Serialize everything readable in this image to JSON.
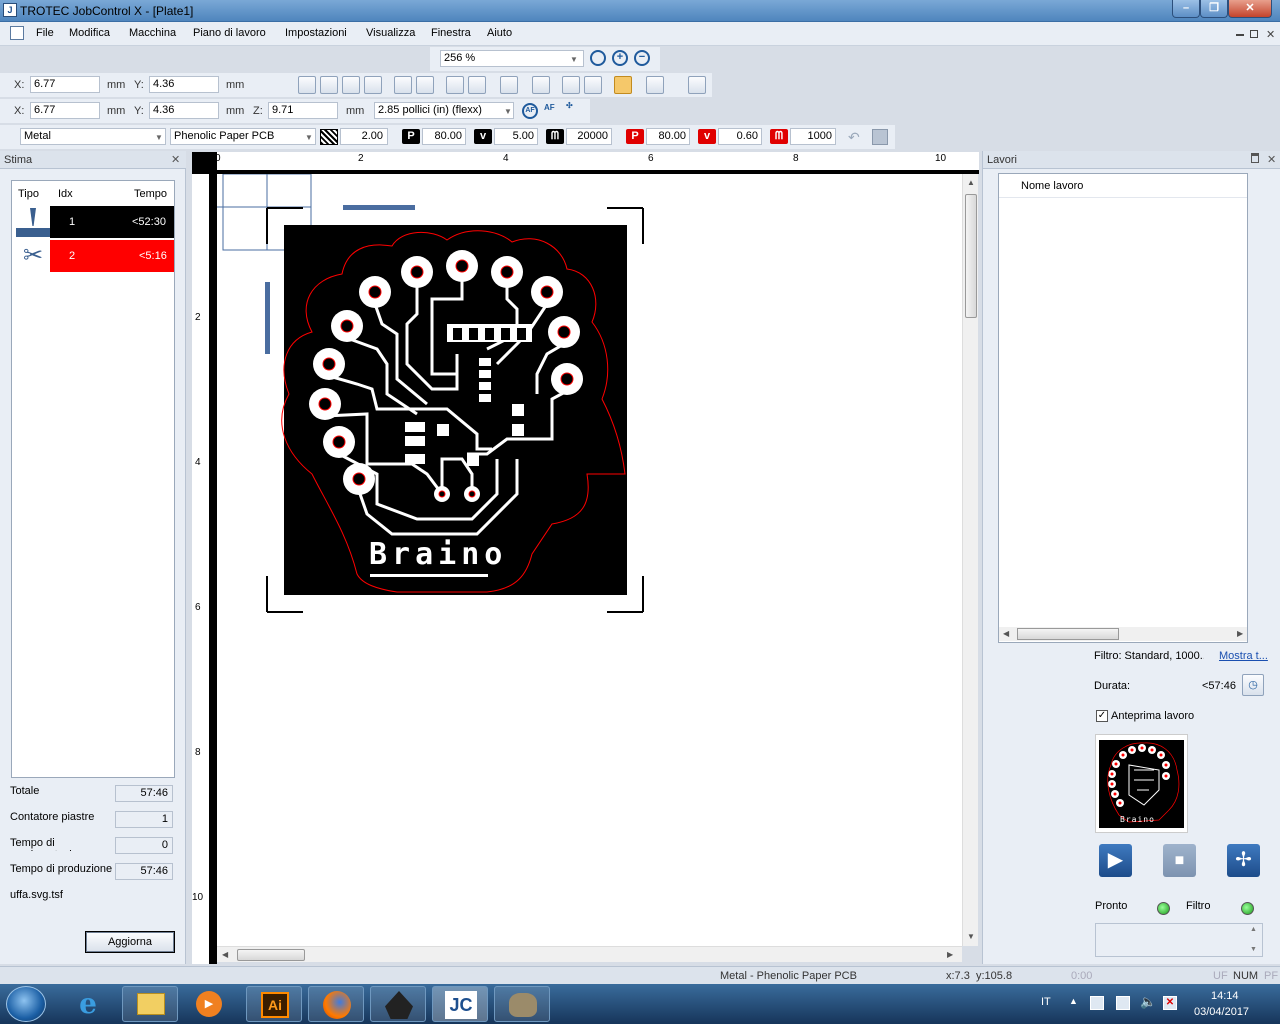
{
  "window": {
    "title": "TROTEC JobControl X - [Plate1]",
    "min": "–",
    "max": "❐",
    "close": "✕"
  },
  "menu": [
    "File",
    "Modifica",
    "Macchina",
    "Piano di lavoro",
    "Impostazioni",
    "Visualizza",
    "Finestra",
    "Aiuto"
  ],
  "zoom": {
    "value": "256 %"
  },
  "coords1": {
    "x_label": "X:",
    "x": "6.77",
    "x_unit": "mm",
    "y_label": "Y:",
    "y": "4.36",
    "y_unit": "mm"
  },
  "coords2": {
    "x_label": "X:",
    "x": "6.77",
    "x_unit": "mm",
    "y_label": "Y:",
    "y": "4.36",
    "y_unit": "mm",
    "z_label": "Z:",
    "z": "9.71",
    "z_unit": "mm",
    "lens": "2.85 pollici (in) (flexx)"
  },
  "material": {
    "group": "Metal",
    "type": "Phenolic Paper PCB",
    "hatch": "2.00",
    "p1_label": "P",
    "p1": "80.00",
    "v1_label": "v",
    "v1": "5.00",
    "f1": "20000",
    "p2_label": "P",
    "p2": "80.00",
    "v2_label": "v",
    "v2": "0.60",
    "f2": "1000"
  },
  "stima": {
    "title": "Stima",
    "close": "✕",
    "headers": {
      "tipo": "Tipo",
      "idx": "Idx",
      "tempo": "Tempo"
    },
    "rows": [
      {
        "idx": "1",
        "tempo": "<52:30",
        "color": "#000000"
      },
      {
        "idx": "2",
        "tempo": "<5:16",
        "color": "#ff0000"
      }
    ],
    "totale_label": "Totale",
    "totale": "57:46",
    "contatore_label": "Contatore piastre",
    "contatore": "1",
    "movimentazione_label": "Tempo di movimentazione",
    "movimentazione": "0",
    "produzione_label": "Tempo di produzione",
    "produzione": "57:46",
    "file": "uffa.svg.tsf",
    "button": "Aggiorna"
  },
  "ruler": {
    "h": [
      "0",
      "2",
      "4",
      "6",
      "8",
      "10"
    ],
    "v": [
      "2",
      "4",
      "6",
      "8",
      "10"
    ]
  },
  "canvas": {
    "logo_text": "Braino"
  },
  "lavori": {
    "title": "Lavori",
    "pin": "ᵖ",
    "close": "✕",
    "col": "Nome lavoro",
    "filtro": "Filtro: Standard, 1000....",
    "mostra": "Mostra t...",
    "durata_label": "Durata:",
    "durata": "<57:46",
    "anteprima": "Anteprima lavoro",
    "thumb_text": "Braino",
    "pronto": "Pronto",
    "filtro2": "Filtro"
  },
  "status": {
    "material": "Metal - Phenolic Paper PCB",
    "x": "x:7.3",
    "y": "y:105.8",
    "t": "0:00",
    "uf": "UF",
    "num": "NUM",
    "pf": "PF"
  },
  "taskbar": {
    "lang": "IT",
    "time": "14:14",
    "date": "03/04/2017"
  }
}
